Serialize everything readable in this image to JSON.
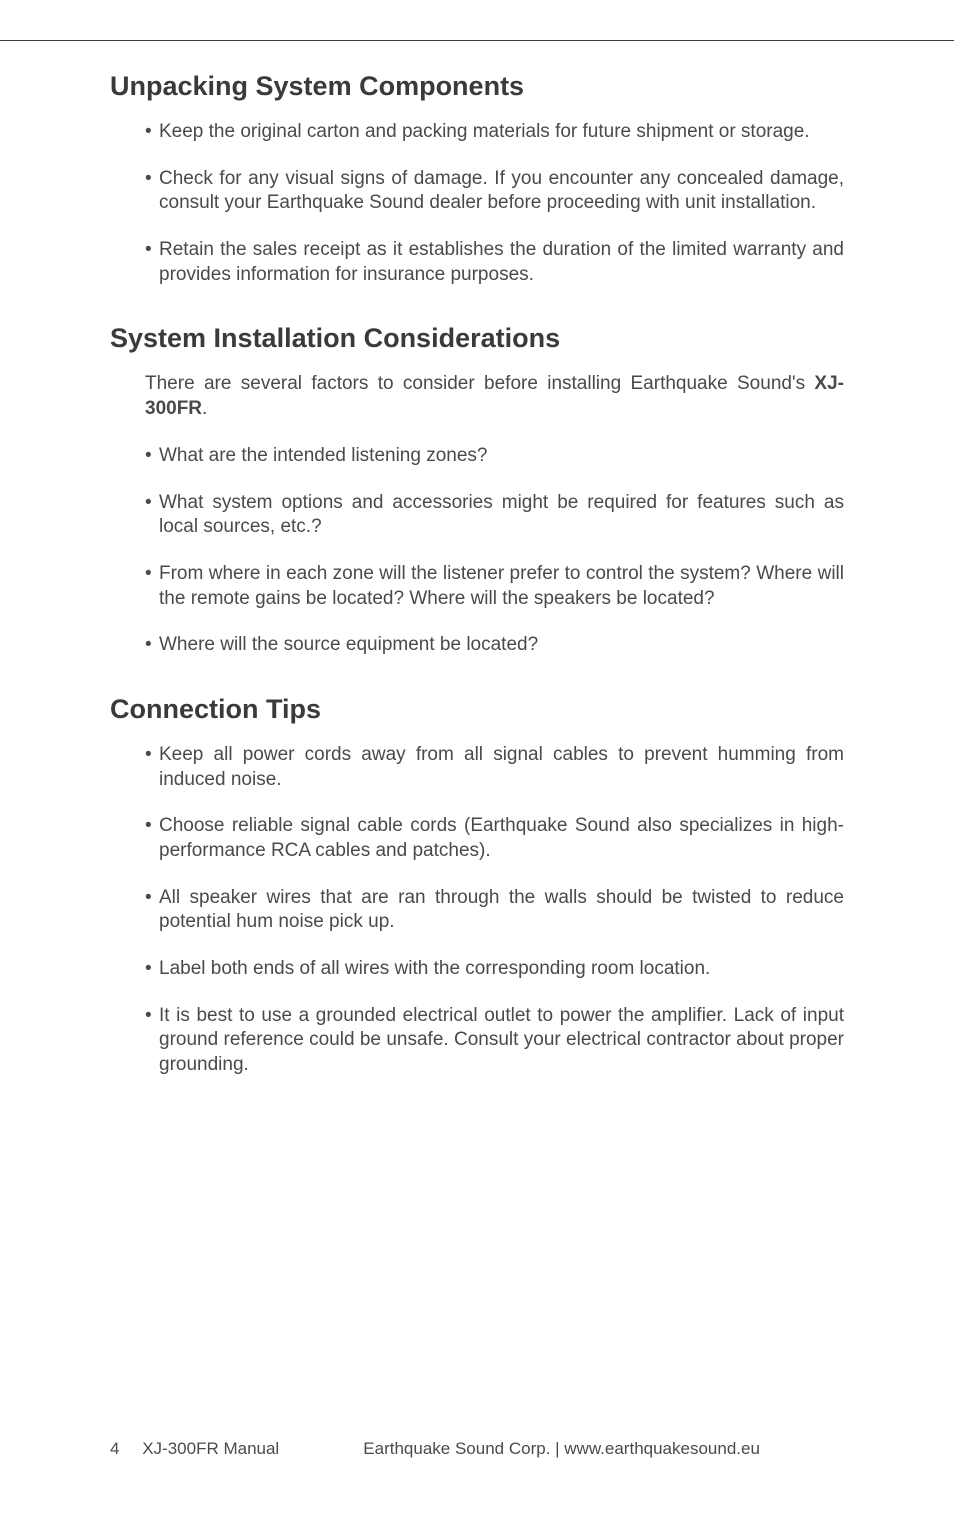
{
  "sections": {
    "unpacking": {
      "heading": "Unpacking System Components",
      "bullets": [
        "Keep the original carton and packing materials for future shipment or storage.",
        "Check for any visual signs of damage. If you encounter any concealed damage, consult your Earthquake Sound dealer before proceeding with unit installation.",
        "Retain the sales receipt as it establishes the duration of the limited warranty and provides information for insurance purposes."
      ]
    },
    "installation": {
      "heading": "System Installation Considerations",
      "intro_pre": "There are several factors to consider before installing Earthquake Sound's ",
      "intro_bold": "XJ-300FR",
      "intro_post": ".",
      "bullets": [
        "What are the intended listening zones?",
        "What system options and accessories might be required for features such as local sources, etc.?",
        "From where in each zone will the listener prefer to control the system? Where will the remote gains be located? Where will the speakers be located?",
        "Where will the source equipment be located?"
      ]
    },
    "connection": {
      "heading": "Connection Tips",
      "bullets": [
        "Keep all power cords away from all signal cables to prevent humming from induced noise.",
        "Choose reliable signal cable cords (Earthquake Sound also specializes in high-performance RCA cables and patches).",
        "All speaker wires that are ran through the walls should be twisted to reduce potential hum noise pick up.",
        "Label both ends of all wires with the corresponding room location.",
        "It is best to use a grounded electrical outlet to power the amplifier. Lack of input ground reference could be unsafe. Consult your electrical contractor about proper grounding."
      ]
    }
  },
  "footer": {
    "page_number": "4",
    "manual_title": "XJ-300FR Manual",
    "company_info": "Earthquake Sound Corp.  |  www.earthquakesound.eu"
  }
}
